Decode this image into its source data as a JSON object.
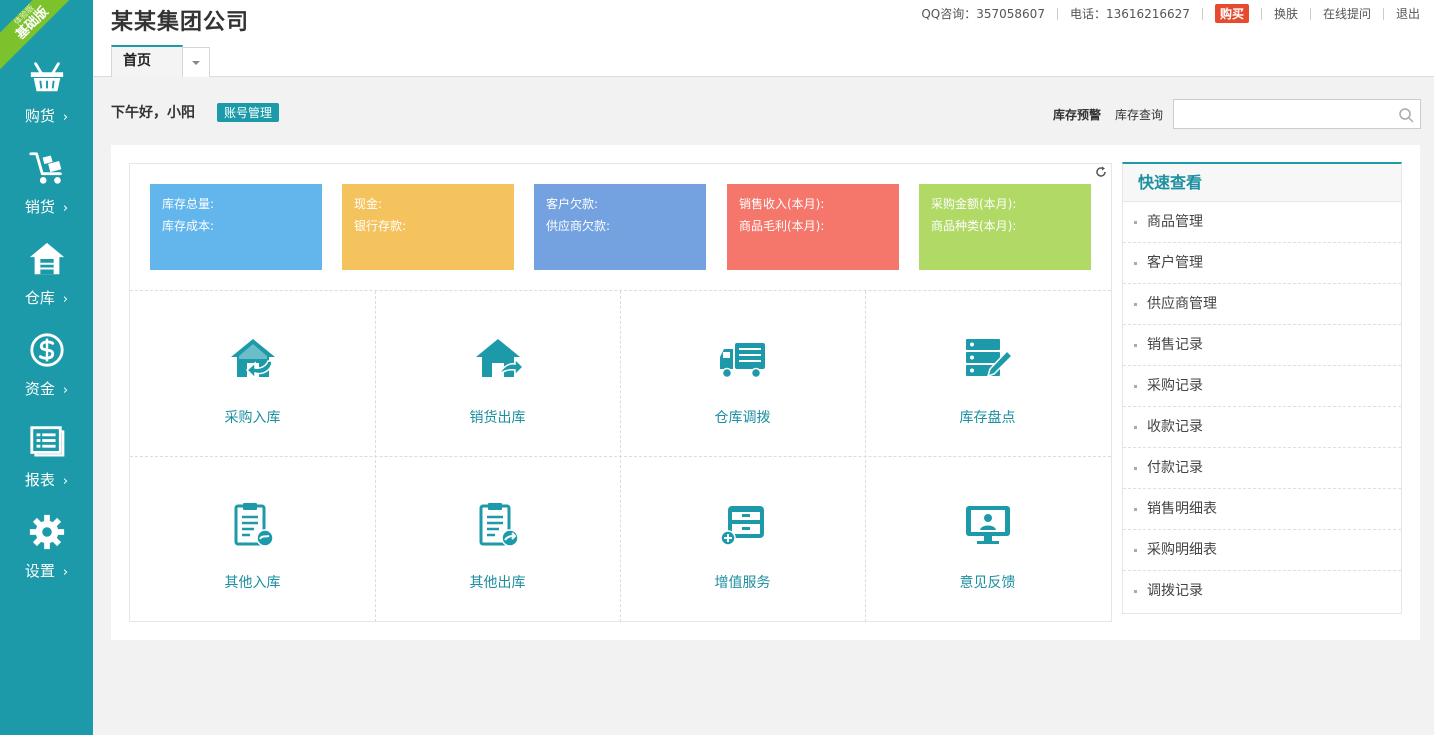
{
  "ribbon": {
    "small": "体验版",
    "big": "基础版"
  },
  "sidebar": {
    "items": [
      {
        "label": "购货",
        "icon": "basket-icon"
      },
      {
        "label": "销货",
        "icon": "cart-icon"
      },
      {
        "label": "仓库",
        "icon": "warehouse-icon"
      },
      {
        "label": "资金",
        "icon": "dollar-icon"
      },
      {
        "label": "报表",
        "icon": "report-icon"
      },
      {
        "label": "设置",
        "icon": "gear-icon"
      }
    ],
    "chevron": "›"
  },
  "header": {
    "company": "某某集团公司",
    "qq": "QQ咨询：357058607",
    "phone": "电话：13616216627",
    "buy": "购买",
    "skin": "换肤",
    "ask": "在线提问",
    "logout": "退出"
  },
  "tabs": {
    "home": "首页"
  },
  "greeting": {
    "text": "下午好，小阳",
    "account_btn": "账号管理"
  },
  "stock": {
    "alert": "库存预警",
    "query": "库存查询",
    "search_placeholder": ""
  },
  "stats": [
    {
      "line1": "库存总量:",
      "line2": "库存成本:",
      "color": "#63b6ec"
    },
    {
      "line1": "现金:",
      "line2": "银行存款:",
      "color": "#f5c35e"
    },
    {
      "line1": "客户欠款:",
      "line2": "供应商欠款:",
      "color": "#74a1e0"
    },
    {
      "line1": "销售收入(本月):",
      "line2": "商品毛利(本月):",
      "color": "#f5766a"
    },
    {
      "line1": "采购金额(本月):",
      "line2": "商品种类(本月):",
      "color": "#b0d966"
    }
  ],
  "actions": [
    {
      "label": "采购入库",
      "icon": "purchase-in-icon"
    },
    {
      "label": "销货出库",
      "icon": "sales-out-icon"
    },
    {
      "label": "仓库调拨",
      "icon": "truck-icon"
    },
    {
      "label": "库存盘点",
      "icon": "inventory-check-icon"
    },
    {
      "label": "其他入库",
      "icon": "other-in-icon"
    },
    {
      "label": "其他出库",
      "icon": "other-out-icon"
    },
    {
      "label": "增值服务",
      "icon": "value-added-icon"
    },
    {
      "label": "意见反馈",
      "icon": "feedback-icon"
    }
  ],
  "quick": {
    "title": "快速查看",
    "items": [
      "商品管理",
      "客户管理",
      "供应商管理",
      "销售记录",
      "采购记录",
      "收款记录",
      "付款记录",
      "销售明细表",
      "采购明细表",
      "调拨记录"
    ]
  },
  "colors": {
    "accent": "#1c9aa9",
    "ribbon": "#7cc22d",
    "buy": "#e64b2e"
  }
}
